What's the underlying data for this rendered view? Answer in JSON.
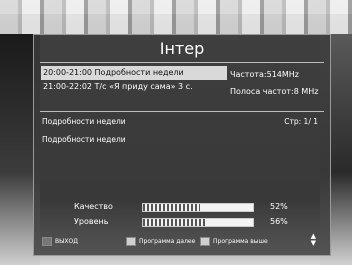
{
  "channel": {
    "name": "Інтер"
  },
  "epg": {
    "events": [
      {
        "text": "20:00-21:00  Подробности недели",
        "selected": true
      },
      {
        "text": "21:00-22:02  Т/с «Я приду сама» 3 с.",
        "selected": false
      }
    ]
  },
  "tuning": {
    "frequency": "Частота:514MHz",
    "bandwidth": "Полоса частот:8 MHz"
  },
  "description": {
    "title": "Подробности недели",
    "page": "Стр:  1/ 1",
    "body": "Подробности недели"
  },
  "signal": {
    "quality_label": "Качество",
    "quality_value": 52,
    "quality_text": "52%",
    "level_label": "Уровень",
    "level_value": 56,
    "level_text": "56%"
  },
  "footer": {
    "exit": "ВЫХОД",
    "prog_down": "Программа далее",
    "prog_up": "Программа выше"
  }
}
